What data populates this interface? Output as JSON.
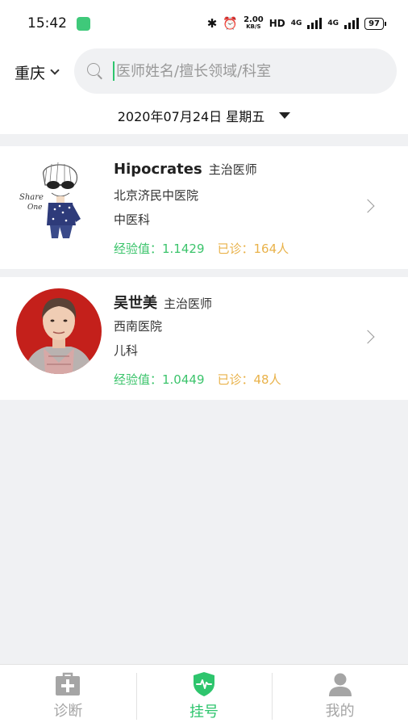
{
  "status_bar": {
    "time": "15:42",
    "speed_value": "2.00",
    "speed_unit": "KB/S",
    "hd": "HD",
    "net1": "4G",
    "net2": "4G",
    "battery": "97",
    "icons": [
      "bluetooth-icon",
      "alarm-icon",
      "signal-icon",
      "battery-icon"
    ]
  },
  "header": {
    "city": "重庆",
    "search_placeholder": "医师姓名/擅长领域/科室"
  },
  "date_filter": {
    "label": "2020年07月24日 星期五"
  },
  "doctors": [
    {
      "name": "Hipocrates",
      "title": "主治医师",
      "hospital": "北京济民中医院",
      "department": "中医科",
      "experience": "经验值：1.1429",
      "visits": "已诊：164人",
      "avatar_text_1": "Share",
      "avatar_text_2": "One"
    },
    {
      "name": "吴世美",
      "title": "主治医师",
      "hospital": "西南医院",
      "department": "儿科",
      "experience": "经验值：1.0449",
      "visits": "已诊：48人"
    }
  ],
  "tabbar": {
    "tabs": [
      {
        "label": "诊断",
        "icon": "medical-kit-icon",
        "active": false
      },
      {
        "label": "挂号",
        "icon": "shield-pulse-icon",
        "active": true
      },
      {
        "label": "我的",
        "icon": "person-icon",
        "active": false
      }
    ]
  },
  "colors": {
    "accent": "#2ec56d",
    "experience": "#3cc46c",
    "visits": "#e9b24a",
    "background": "#f0f1f3"
  }
}
